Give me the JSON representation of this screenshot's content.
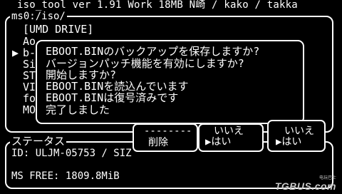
{
  "header": {
    "text": "iso_tool ver 1.91 Work 18MB    N崎 / kako / takka"
  },
  "browser": {
    "path": "ms0:/iso/",
    "cursor_glyph": "▶",
    "items": [
      "[UMD DRIVE]",
      "Ao",
      "b-",
      "Si",
      "ST",
      "VI",
      "fo",
      "MO"
    ],
    "selected_index": 2
  },
  "dialog": {
    "lines": [
      "EBOOT.BINのバックアップを保存しますか?",
      "バージョンパッチ機能を有効にしますか?",
      "開始しますか?",
      "EBOOT.BINを読込んでいます",
      "EBOOT.BINは復号済みです",
      "完了しました"
    ]
  },
  "menus": {
    "delete": {
      "separator": "--------",
      "label": "削除"
    },
    "q1": {
      "no": "いいえ",
      "yes": "▶はい"
    },
    "q2": {
      "no": "いいえ",
      "yes": "▶はい"
    }
  },
  "status": {
    "label": "ステータス",
    "id_line": "ID: ULJM-05753 / SIZ",
    "free_line": "MS FREE: 1809.8MiB"
  },
  "watermark": {
    "small": "电玩巴士",
    "big": "TGBUS.com"
  }
}
